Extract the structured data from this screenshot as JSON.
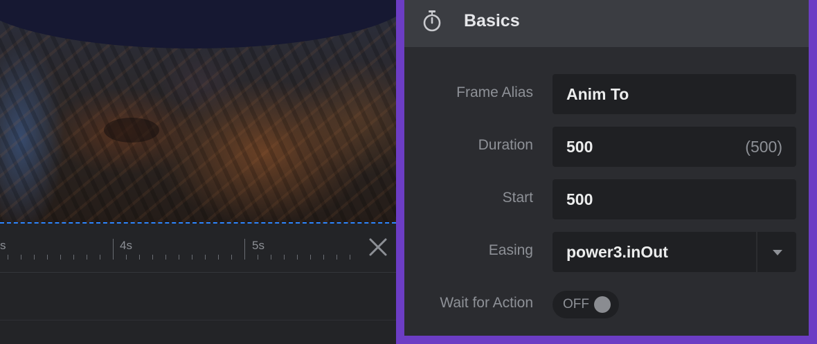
{
  "timeline": {
    "tick_labels": [
      {
        "text": "s"
      },
      {
        "text": "4s"
      },
      {
        "text": "5s"
      }
    ]
  },
  "panel": {
    "accent_color": "#6c3dc4",
    "header": {
      "title": "Basics",
      "icon": "stopwatch-icon"
    },
    "fields": {
      "frame_alias": {
        "label": "Frame Alias",
        "value": "Anim To"
      },
      "duration": {
        "label": "Duration",
        "value": "500",
        "hint": "(500)"
      },
      "start": {
        "label": "Start",
        "value": "500"
      },
      "easing": {
        "label": "Easing",
        "value": "power3.inOut"
      },
      "wait_for_action": {
        "label": "Wait for Action",
        "state": "OFF"
      }
    }
  }
}
